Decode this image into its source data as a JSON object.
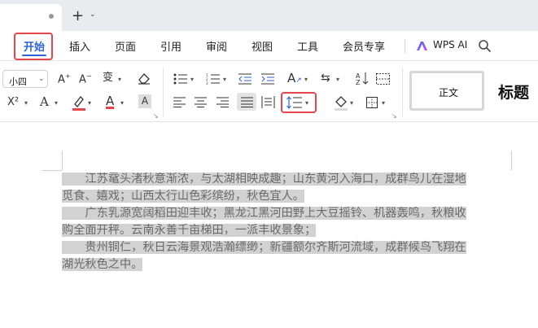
{
  "window": {
    "new_tab_symbol": "+",
    "new_tab_caret": "⌄"
  },
  "menu": {
    "items": [
      "开始",
      "插入",
      "页面",
      "引用",
      "审阅",
      "视图",
      "工具",
      "会员专享"
    ],
    "active": "开始",
    "wps_ai": "WPS AI",
    "accent_color": "#2d62d8",
    "highlight_box_color": "#e4474b"
  },
  "ribbon": {
    "font_size": "小四",
    "style_normal": "正文",
    "style_heading": "标题",
    "letter_a": "A",
    "superscript_x": "X²",
    "text_char": "文",
    "icons": [
      "grow-font",
      "shrink-font",
      "pinyin",
      "clear-format",
      "bullet-list",
      "numbered-list",
      "decrease-indent",
      "increase-indent",
      "text-direction",
      "sort",
      "sort-az",
      "table-lines",
      "superscript",
      "text-effect",
      "highlight",
      "font-color",
      "char-shading",
      "align-left",
      "align-center",
      "align-right",
      "justify",
      "distribute",
      "line-spacing",
      "fill",
      "border"
    ]
  },
  "document": {
    "lines": [
      "　　江苏鼋头渚秋意渐浓，与太湖相映成趣；山东黄河入海口，成群鸟儿在湿地",
      "觅食、嬉戏；山西太行山色彩缤纷，秋色宜人。",
      "　　广东乳源宽阔稻田迎丰收；黑龙江黑河田野上大豆摇铃、机器轰鸣，秋粮收",
      "购全面开秤。云南永善千亩梯田，一派丰收景象；",
      "　　贵州铜仁，秋日云海景观浩瀚缥缈；新疆额尔齐斯河流域，成群候鸟飞翔在",
      "湖光秋色之中。"
    ],
    "selection_color": "#d2d2d2"
  }
}
